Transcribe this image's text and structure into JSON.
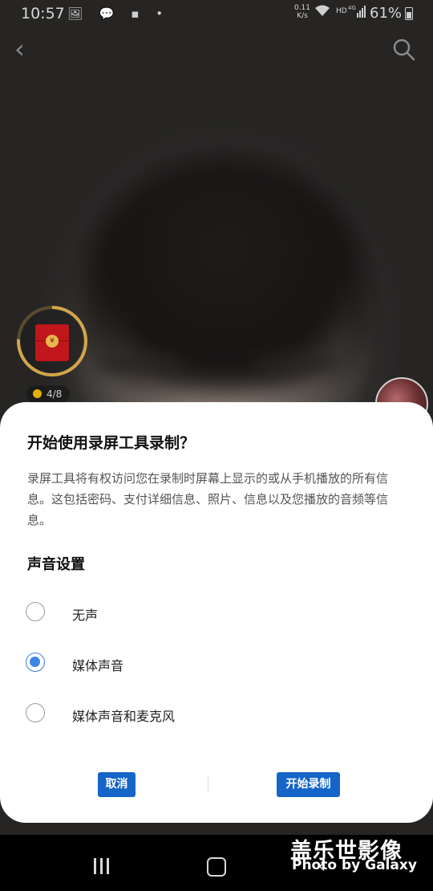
{
  "status_bar": {
    "time": "10:57",
    "notification_icons": "🖼 💬 ▪ •",
    "net_speed_value": "0.11",
    "net_speed_unit": "K/s",
    "network_type": "HD",
    "signal_label": "4G",
    "battery": "61%"
  },
  "topbar": {
    "back_glyph": "‹",
    "search_icon": "search-icon"
  },
  "overlay": {
    "redpacket_seal": "¥",
    "counter": "4/8"
  },
  "dialog": {
    "title": "开始使用录屏工具录制？",
    "body": "录屏工具将有权访问您在录制时屏幕上显示的或从手机播放的所有信息。这包括密码、支付详细信息、照片、信息以及您播放的音频等信息。",
    "section_title": "声音设置",
    "options": [
      {
        "label": "无声",
        "selected": false
      },
      {
        "label": "媒体声音",
        "selected": true
      },
      {
        "label": "媒体声音和麦克风",
        "selected": false
      }
    ],
    "cancel_label": "取消",
    "start_label": "开始录制"
  },
  "navbar": {
    "back_glyph": "‹"
  },
  "watermark": {
    "title": "盖乐世影像",
    "subtitle": "Photo by Galaxy"
  },
  "colors": {
    "accent": "#1565c9",
    "radio_selected": "#3e86e6"
  }
}
